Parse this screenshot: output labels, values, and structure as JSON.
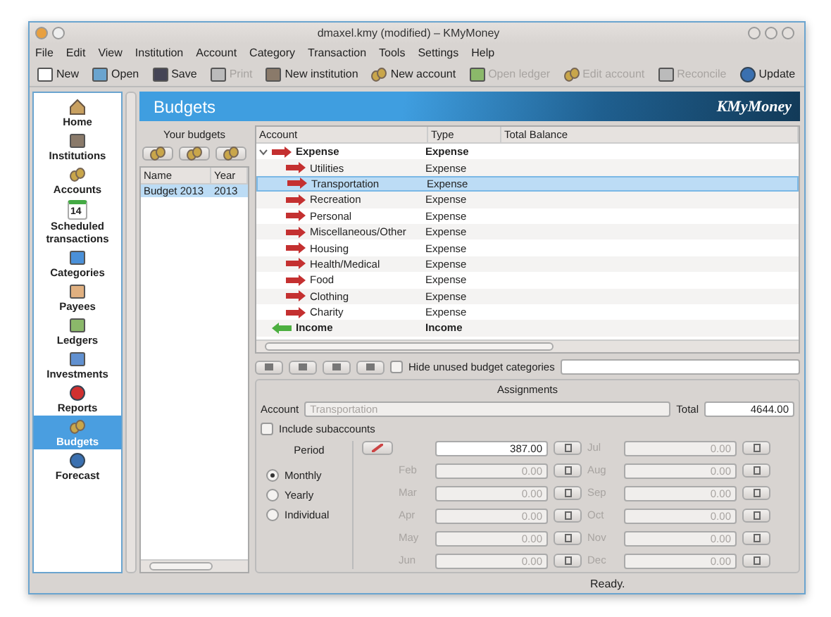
{
  "window": {
    "title": "dmaxel.kmy (modified) – KMyMoney"
  },
  "menu": [
    "File",
    "Edit",
    "View",
    "Institution",
    "Account",
    "Category",
    "Transaction",
    "Tools",
    "Settings",
    "Help"
  ],
  "toolbar": [
    {
      "label": "New",
      "disabled": false
    },
    {
      "label": "Open",
      "disabled": false
    },
    {
      "label": "Save",
      "disabled": false
    },
    {
      "label": "Print",
      "disabled": true
    },
    {
      "label": "New institution",
      "disabled": false
    },
    {
      "label": "New account",
      "disabled": false
    },
    {
      "label": "Open ledger",
      "disabled": true
    },
    {
      "label": "Edit account",
      "disabled": true
    },
    {
      "label": "Reconcile",
      "disabled": true
    },
    {
      "label": "Update",
      "disabled": false
    }
  ],
  "sidebar": {
    "items": [
      {
        "label": "Home",
        "selected": false
      },
      {
        "label": "Institutions",
        "selected": false
      },
      {
        "label": "Accounts",
        "selected": false
      },
      {
        "label": "Scheduled transactions",
        "day": "14",
        "selected": false
      },
      {
        "label": "Categories",
        "selected": false
      },
      {
        "label": "Payees",
        "selected": false
      },
      {
        "label": "Ledgers",
        "selected": false
      },
      {
        "label": "Investments",
        "selected": false
      },
      {
        "label": "Reports",
        "selected": false
      },
      {
        "label": "Budgets",
        "selected": true
      },
      {
        "label": "Forecast",
        "selected": false
      }
    ]
  },
  "page": {
    "title": "Budgets",
    "logo": "KMyMoney"
  },
  "budgets": {
    "title": "Your budgets",
    "columns": [
      "Name",
      "Year"
    ],
    "rows": [
      {
        "name": "Budget 2013",
        "year": "2013",
        "selected": true
      }
    ]
  },
  "tree": {
    "columns": [
      "Account",
      "Type",
      "Total Balance"
    ],
    "rows": [
      {
        "name": "Expense",
        "type": "Expense",
        "kind": "expense",
        "expanded": true,
        "selected": false,
        "children": [
          {
            "name": "Utilities",
            "type": "Expense",
            "kind": "expense",
            "selected": false
          },
          {
            "name": "Transportation",
            "type": "Expense",
            "kind": "expense",
            "selected": true
          },
          {
            "name": "Recreation",
            "type": "Expense",
            "kind": "expense",
            "selected": false
          },
          {
            "name": "Personal",
            "type": "Expense",
            "kind": "expense",
            "selected": false
          },
          {
            "name": "Miscellaneous/Other",
            "type": "Expense",
            "kind": "expense",
            "selected": false
          },
          {
            "name": "Housing",
            "type": "Expense",
            "kind": "expense",
            "selected": false
          },
          {
            "name": "Health/Medical",
            "type": "Expense",
            "kind": "expense",
            "selected": false
          },
          {
            "name": "Food",
            "type": "Expense",
            "kind": "expense",
            "selected": false
          },
          {
            "name": "Clothing",
            "type": "Expense",
            "kind": "expense",
            "selected": false
          },
          {
            "name": "Charity",
            "type": "Expense",
            "kind": "expense",
            "selected": false
          }
        ]
      },
      {
        "name": "Income",
        "type": "Income",
        "kind": "income",
        "selected": false
      }
    ]
  },
  "hide_unused": {
    "label": "Hide unused budget categories",
    "checked": false
  },
  "assignments": {
    "title": "Assignments",
    "account_label": "Account",
    "account": "Transportation",
    "total_label": "Total",
    "total": "4644.00",
    "include_subaccounts": {
      "label": "Include subaccounts",
      "checked": false
    },
    "period_title": "Period",
    "periods": [
      {
        "label": "Monthly",
        "selected": true
      },
      {
        "label": "Yearly",
        "selected": false
      },
      {
        "label": "Individual",
        "selected": false
      }
    ],
    "months": [
      {
        "value": "387.00",
        "disabled": false
      },
      {
        "label": "Feb",
        "value": "0.00",
        "disabled": true
      },
      {
        "label": "Mar",
        "value": "0.00",
        "disabled": true
      },
      {
        "label": "Apr",
        "value": "0.00",
        "disabled": true
      },
      {
        "label": "May",
        "value": "0.00",
        "disabled": true
      },
      {
        "label": "Jun",
        "value": "0.00",
        "disabled": true
      },
      {
        "label": "Jul",
        "value": "0.00",
        "disabled": true
      },
      {
        "label": "Aug",
        "value": "0.00",
        "disabled": true
      },
      {
        "label": "Sep",
        "value": "0.00",
        "disabled": true
      },
      {
        "label": "Oct",
        "value": "0.00",
        "disabled": true
      },
      {
        "label": "Nov",
        "value": "0.00",
        "disabled": true
      },
      {
        "label": "Dec",
        "value": "0.00",
        "disabled": true
      }
    ]
  },
  "status_bar": {
    "text": "Ready."
  }
}
